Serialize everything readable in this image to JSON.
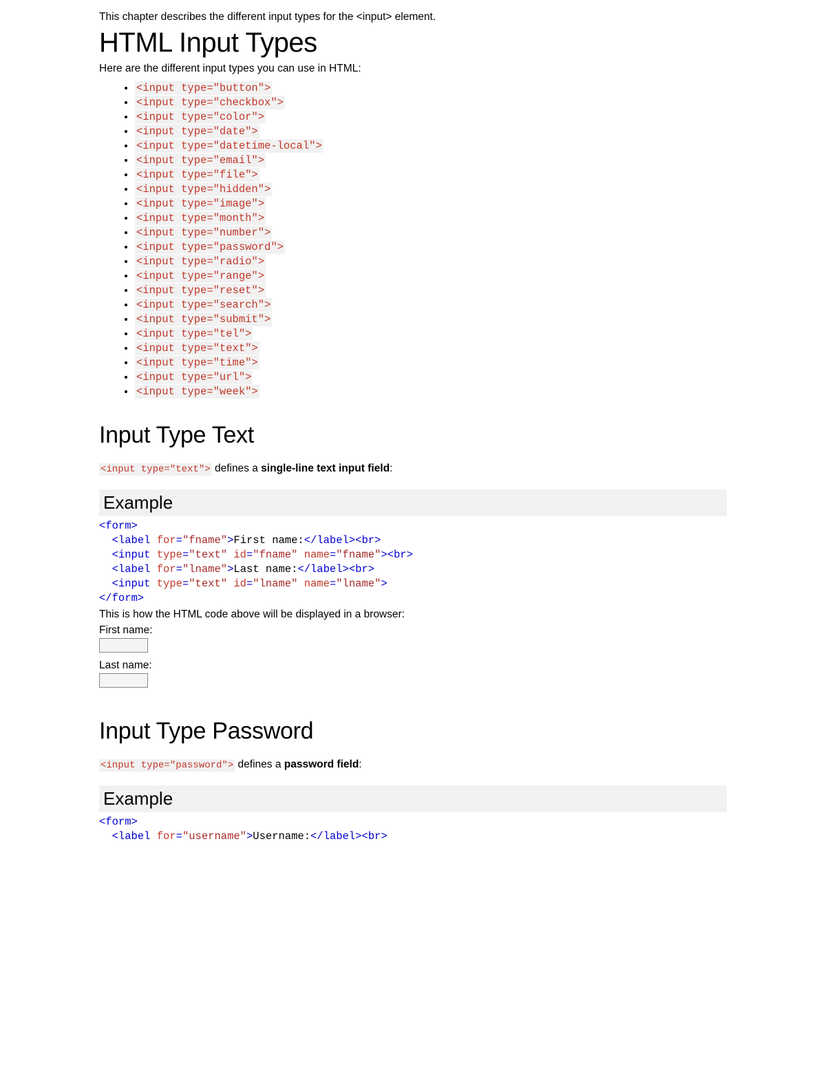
{
  "intro": "This chapter describes the different input types for the <input> element.",
  "h1": "HTML Input Types",
  "lead": "Here are the different input types you can use in HTML:",
  "types": [
    "<input type=\"button\">",
    "<input type=\"checkbox\">",
    "<input type=\"color\">",
    "<input type=\"date\">",
    "<input type=\"datetime-local\">",
    "<input type=\"email\">",
    "<input type=\"file\">",
    "<input type=\"hidden\">",
    "<input type=\"image\">",
    "<input type=\"month\">",
    "<input type=\"number\">",
    "<input type=\"password\">",
    "<input type=\"radio\">",
    "<input type=\"range\">",
    "<input type=\"reset\">",
    "<input type=\"search\">",
    "<input type=\"submit\">",
    "<input type=\"tel\">",
    "<input type=\"text\">",
    "<input type=\"time\">",
    "<input type=\"url\">",
    "<input type=\"week\">"
  ],
  "section_text": {
    "heading": "Input Type Text",
    "code_inline": "<input type=\"text\">",
    "desc_prefix": " defines a ",
    "desc_bold": "single-line text input field",
    "desc_suffix": ":",
    "example_label": "Example",
    "browser_note": "This is how the HTML code above will be displayed in a browser:",
    "label_first": "First name:",
    "label_last": "Last name:",
    "code": {
      "form_open": "<form>",
      "indent": "  ",
      "label1": {
        "tag_open": "<label",
        "attr": " for",
        "eq": "=",
        "val": "\"fname\"",
        "tag_close": ">",
        "text": "First name:",
        "close": "</label>",
        "br": "<br>"
      },
      "input1": {
        "tag_open": "<input",
        "type_attr": " type",
        "type_val": "\"text\"",
        "id_attr": " id",
        "id_val": "\"fname\"",
        "name_attr": " name",
        "name_val": "\"fname\"",
        "tag_close": ">",
        "br": "<br>"
      },
      "label2": {
        "tag_open": "<label",
        "attr": " for",
        "eq": "=",
        "val": "\"lname\"",
        "tag_close": ">",
        "text": "Last name:",
        "close": "</label>",
        "br": "<br>"
      },
      "input2": {
        "tag_open": "<input",
        "type_attr": " type",
        "type_val": "\"text\"",
        "id_attr": " id",
        "id_val": "\"lname\"",
        "name_attr": " name",
        "name_val": "\"lname\"",
        "tag_close": ">"
      },
      "form_close": "</form>"
    }
  },
  "section_pwd": {
    "heading": "Input Type Password",
    "code_inline": "<input type=\"password\">",
    "desc_prefix": " defines a ",
    "desc_bold": "password field",
    "desc_suffix": ":",
    "example_label": "Example",
    "code": {
      "form_open": "<form>",
      "indent": "  ",
      "label1": {
        "tag_open": "<label",
        "attr": " for",
        "eq": "=",
        "val": "\"username\"",
        "tag_close": ">",
        "text": "Username:",
        "close": "</label>",
        "br": "<br>"
      }
    }
  }
}
